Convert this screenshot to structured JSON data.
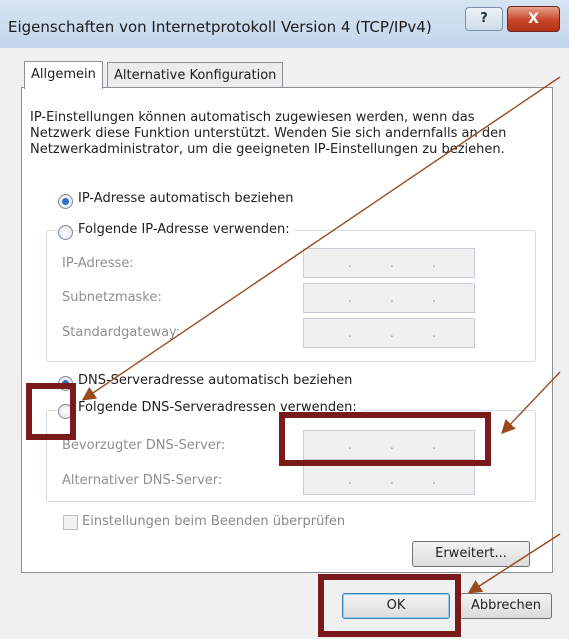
{
  "window": {
    "title": "Eigenschaften von Internetprotokoll Version 4 (TCP/IPv4)",
    "help_label": "?",
    "close_label": "X"
  },
  "tabs": [
    {
      "label": "Allgemein",
      "active": true
    },
    {
      "label": "Alternative Konfiguration",
      "active": false
    }
  ],
  "description": "IP-Einstellungen können automatisch zugewiesen werden, wenn das Netzwerk diese Funktion unterstützt. Wenden Sie sich andernfalls an den Netzwerkadministrator, um die geeigneten IP-Einstellungen zu beziehen.",
  "ip": {
    "auto_label": "IP-Adresse automatisch beziehen",
    "manual_label": "Folgende IP-Adresse verwenden:",
    "selected": "auto",
    "fields": [
      {
        "label": "IP-Adresse:",
        "value": ".   .   ."
      },
      {
        "label": "Subnetzmaske:",
        "value": ".   .   ."
      },
      {
        "label": "Standardgateway:",
        "value": ".   .   ."
      }
    ]
  },
  "dns": {
    "auto_label": "DNS-Serveradresse automatisch beziehen",
    "manual_label": "Folgende DNS-Serveradressen verwenden:",
    "selected": "auto",
    "fields": [
      {
        "label": "Bevorzugter DNS-Server:",
        "value": ".   .   ."
      },
      {
        "label": "Alternativer DNS-Server:",
        "value": ".   .   ."
      }
    ]
  },
  "validate_label": "Einstellungen beim Beenden überprüfen",
  "buttons": {
    "advanced": "Erweitert...",
    "ok": "OK",
    "cancel": "Abbrechen"
  },
  "annotation_color": "#7a1a1a",
  "arrow_color": "#9a4a1e"
}
